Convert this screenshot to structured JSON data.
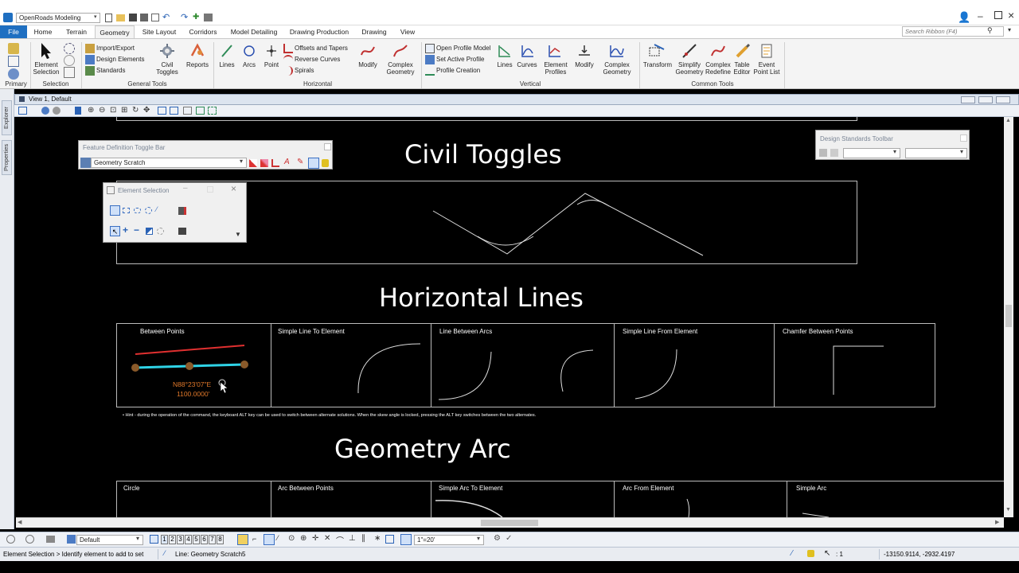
{
  "app": {
    "workflow": "OpenRoads Modeling",
    "search_placeholder": "Search Ribbon (F4)"
  },
  "tabs": [
    "File",
    "Home",
    "Terrain",
    "Geometry",
    "Site Layout",
    "Corridors",
    "Model Detailing",
    "Drawing Production",
    "Drawing",
    "View"
  ],
  "ribbon": {
    "primary_label": "Primary",
    "selection": {
      "button": "Element Selection",
      "group": "Selection"
    },
    "general_tools": {
      "group": "General Tools",
      "import_export": "Import/Export",
      "design_elements": "Design Elements",
      "standards": "Standards",
      "civil_toggles": "Civil Toggles",
      "reports": "Reports"
    },
    "horizontal": {
      "group": "Horizontal",
      "lines": "Lines",
      "arcs": "Arcs",
      "point": "Point",
      "offsets": "Offsets and Tapers",
      "reverse_curves": "Reverse Curves",
      "spirals": "Spirals",
      "modify": "Modify",
      "complex_geometry": "Complex Geometry"
    },
    "vertical": {
      "group": "Vertical",
      "open_profile": "Open Profile Model",
      "set_active_profile": "Set Active Profile",
      "profile_creation": "Profile Creation",
      "lines": "Lines",
      "curves": "Curves",
      "element_profiles": "Element Profiles",
      "modify": "Modify",
      "complex_geometry": "Complex Geometry"
    },
    "common_tools": {
      "group": "Common Tools",
      "transform": "Transform",
      "simplify": "Simplify Geometry",
      "complex_redefine": "Complex Redefine",
      "table_editor": "Table Editor",
      "event_point": "Event Point List"
    }
  },
  "left_tabs": [
    "Explorer",
    "Properties"
  ],
  "view": {
    "title": "View 1, Default"
  },
  "drawing": {
    "civil_toggles_title": "Civil Toggles",
    "horizontal_lines_title": "Horizontal Lines",
    "geometry_arc_title": "Geometry Arc",
    "line_cells": [
      "Between Points",
      "Simple Line To Element",
      "Line Between Arcs",
      "Simple Line From Element",
      "Chamfer Between Points"
    ],
    "bearing": "N88°23'07\"E",
    "distance": "1100.0000'",
    "hint": "• Hint - during the operation of the command, the keyboard ALT key can be used to switch between alternate solutions. When the skew angle is locked, pressing the ALT key switches between the two alternates.",
    "arc_cells": [
      "Circle",
      "Arc Between Points",
      "Simple Arc To Element",
      "Arc  From Element",
      "Simple Arc"
    ]
  },
  "toolbars": {
    "feature_def_title": "Feature Definition Toggle Bar",
    "feature_def_value": "Geometry Scratch",
    "element_selection_title": "Element Selection",
    "design_standards_title": "Design Standards Toolbar"
  },
  "bottom": {
    "level": "Default",
    "views": [
      "1",
      "2",
      "3",
      "4",
      "5",
      "6",
      "7",
      "8"
    ],
    "scale": "1\"=20'"
  },
  "status": {
    "left": "Element Selection > Identify element to add to set",
    "mid": "Line: Geometry Scratch5",
    "count": ": 1",
    "coords": "-13150.9114, -2932.4197"
  },
  "colors": {
    "file_tab": "#1f6fc1",
    "ribbon_bg": "#f4f4f4",
    "cyan_line": "#2fd3e6",
    "red_line": "#e03030",
    "label_orange": "#e0782a"
  }
}
